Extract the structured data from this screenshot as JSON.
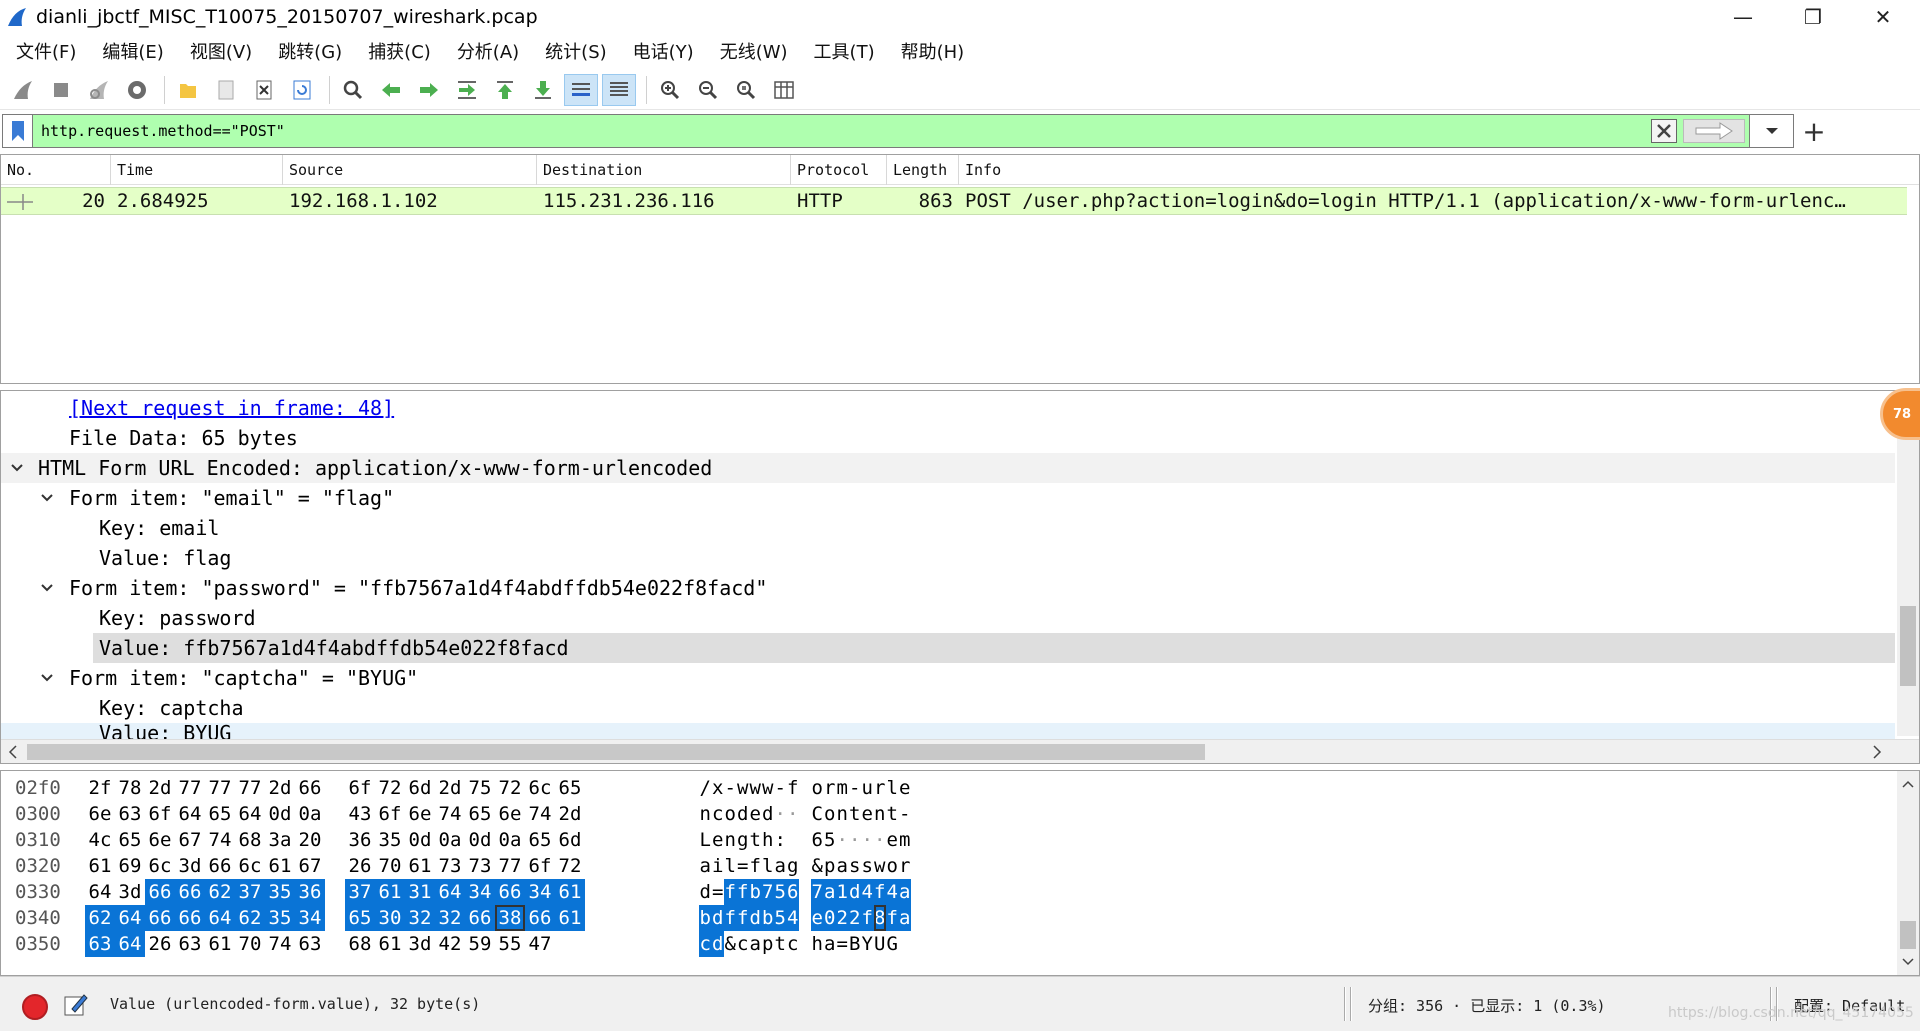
{
  "window": {
    "title": "dianli_jbctf_MISC_T10075_20150707_wireshark.pcap",
    "min_glyph": "—",
    "max_glyph": "❐",
    "close_glyph": "✕"
  },
  "menu": [
    "文件(F)",
    "编辑(E)",
    "视图(V)",
    "跳转(G)",
    "捕获(C)",
    "分析(A)",
    "统计(S)",
    "电话(Y)",
    "无线(W)",
    "工具(T)",
    "帮助(H)"
  ],
  "toolbar_icons": [
    "shark-fin-start-icon",
    "stop-icon",
    "restart-icon",
    "capture-options-icon",
    "open-file-icon",
    "save-file-icon",
    "close-file-icon",
    "reload-icon",
    "find-packet-icon",
    "go-back-icon",
    "go-forward-icon",
    "go-to-packet-icon",
    "go-first-icon",
    "go-last-icon",
    "auto-scroll-icon",
    "colorize-icon",
    "zoom-in-icon",
    "zoom-out-icon",
    "zoom-normal-icon",
    "resize-columns-icon"
  ],
  "filter": {
    "value": "http.request.method==\"POST\"",
    "background": "#afffaf"
  },
  "packet_list": {
    "columns": [
      "No.",
      "Time",
      "Source",
      "Destination",
      "Protocol",
      "Length",
      "Info"
    ],
    "rows": [
      {
        "no": "20",
        "time": "2.684925",
        "source": "192.168.1.102",
        "destination": "115.231.236.116",
        "protocol": "HTTP",
        "length": "863",
        "info": "POST /user.php?action=login&do=login HTTP/1.1  (application/x-www-form-urlenc…"
      }
    ]
  },
  "details": {
    "next_request": "[Next request in frame: 48]",
    "file_data": "File Data: 65 bytes",
    "form_header": "HTML Form URL Encoded: application/x-www-form-urlencoded",
    "item_email": "Form item: \"email\" = \"flag\"",
    "email_key": "Key: email",
    "email_value": "Value: flag",
    "item_password": "Form item: \"password\" = \"ffb7567a1d4f4abdffdb54e022f8facd\"",
    "password_key": "Key: password",
    "password_value": "Value: ffb7567a1d4f4abdffdb54e022f8facd",
    "item_captcha": "Form item: \"captcha\" = \"BYUG\"",
    "captcha_key": "Key: captcha",
    "captcha_value": "Value: BYUG",
    "expert_badge": "78"
  },
  "bytes": [
    {
      "offset": "02f0",
      "hex": [
        "2f",
        "78",
        "2d",
        "77",
        "77",
        "77",
        "2d",
        "66",
        "6f",
        "72",
        "6d",
        "2d",
        "75",
        "72",
        "6c",
        "65"
      ],
      "ascii": "/x-www-form-urle"
    },
    {
      "offset": "0300",
      "hex": [
        "6e",
        "63",
        "6f",
        "64",
        "65",
        "64",
        "0d",
        "0a",
        "43",
        "6f",
        "6e",
        "74",
        "65",
        "6e",
        "74",
        "2d"
      ],
      "ascii": "ncoded··Content-"
    },
    {
      "offset": "0310",
      "hex": [
        "4c",
        "65",
        "6e",
        "67",
        "74",
        "68",
        "3a",
        "20",
        "36",
        "35",
        "0d",
        "0a",
        "0d",
        "0a",
        "65",
        "6d"
      ],
      "ascii": "Length: 65····em"
    },
    {
      "offset": "0320",
      "hex": [
        "61",
        "69",
        "6c",
        "3d",
        "66",
        "6c",
        "61",
        "67",
        "26",
        "70",
        "61",
        "73",
        "73",
        "77",
        "6f",
        "72"
      ],
      "ascii": "ail=flag&passwor"
    },
    {
      "offset": "0330",
      "hex": [
        "64",
        "3d",
        "66",
        "66",
        "62",
        "37",
        "35",
        "36",
        "37",
        "61",
        "31",
        "64",
        "34",
        "66",
        "34",
        "61"
      ],
      "ascii": "d=ffb7567a1d4f4a"
    },
    {
      "offset": "0340",
      "hex": [
        "62",
        "64",
        "66",
        "66",
        "64",
        "62",
        "35",
        "34",
        "65",
        "30",
        "32",
        "32",
        "66",
        "38",
        "66",
        "61"
      ],
      "ascii": "bdffdb54e022f8fa"
    },
    {
      "offset": "0350",
      "hex": [
        "63",
        "64",
        "26",
        "63",
        "61",
        "70",
        "74",
        "63",
        "68",
        "61",
        "3d",
        "42",
        "59",
        "55",
        "47"
      ],
      "ascii": "cd&captcha=BYUG"
    }
  ],
  "status": {
    "field_info": "Value (urlencoded-form.value), 32 byte(s)",
    "packets": "分组: 356 · 已显示: 1 (0.3%)",
    "profile": "配置: Default",
    "watermark": "https://blog.csdn.net/qq_45174055"
  }
}
